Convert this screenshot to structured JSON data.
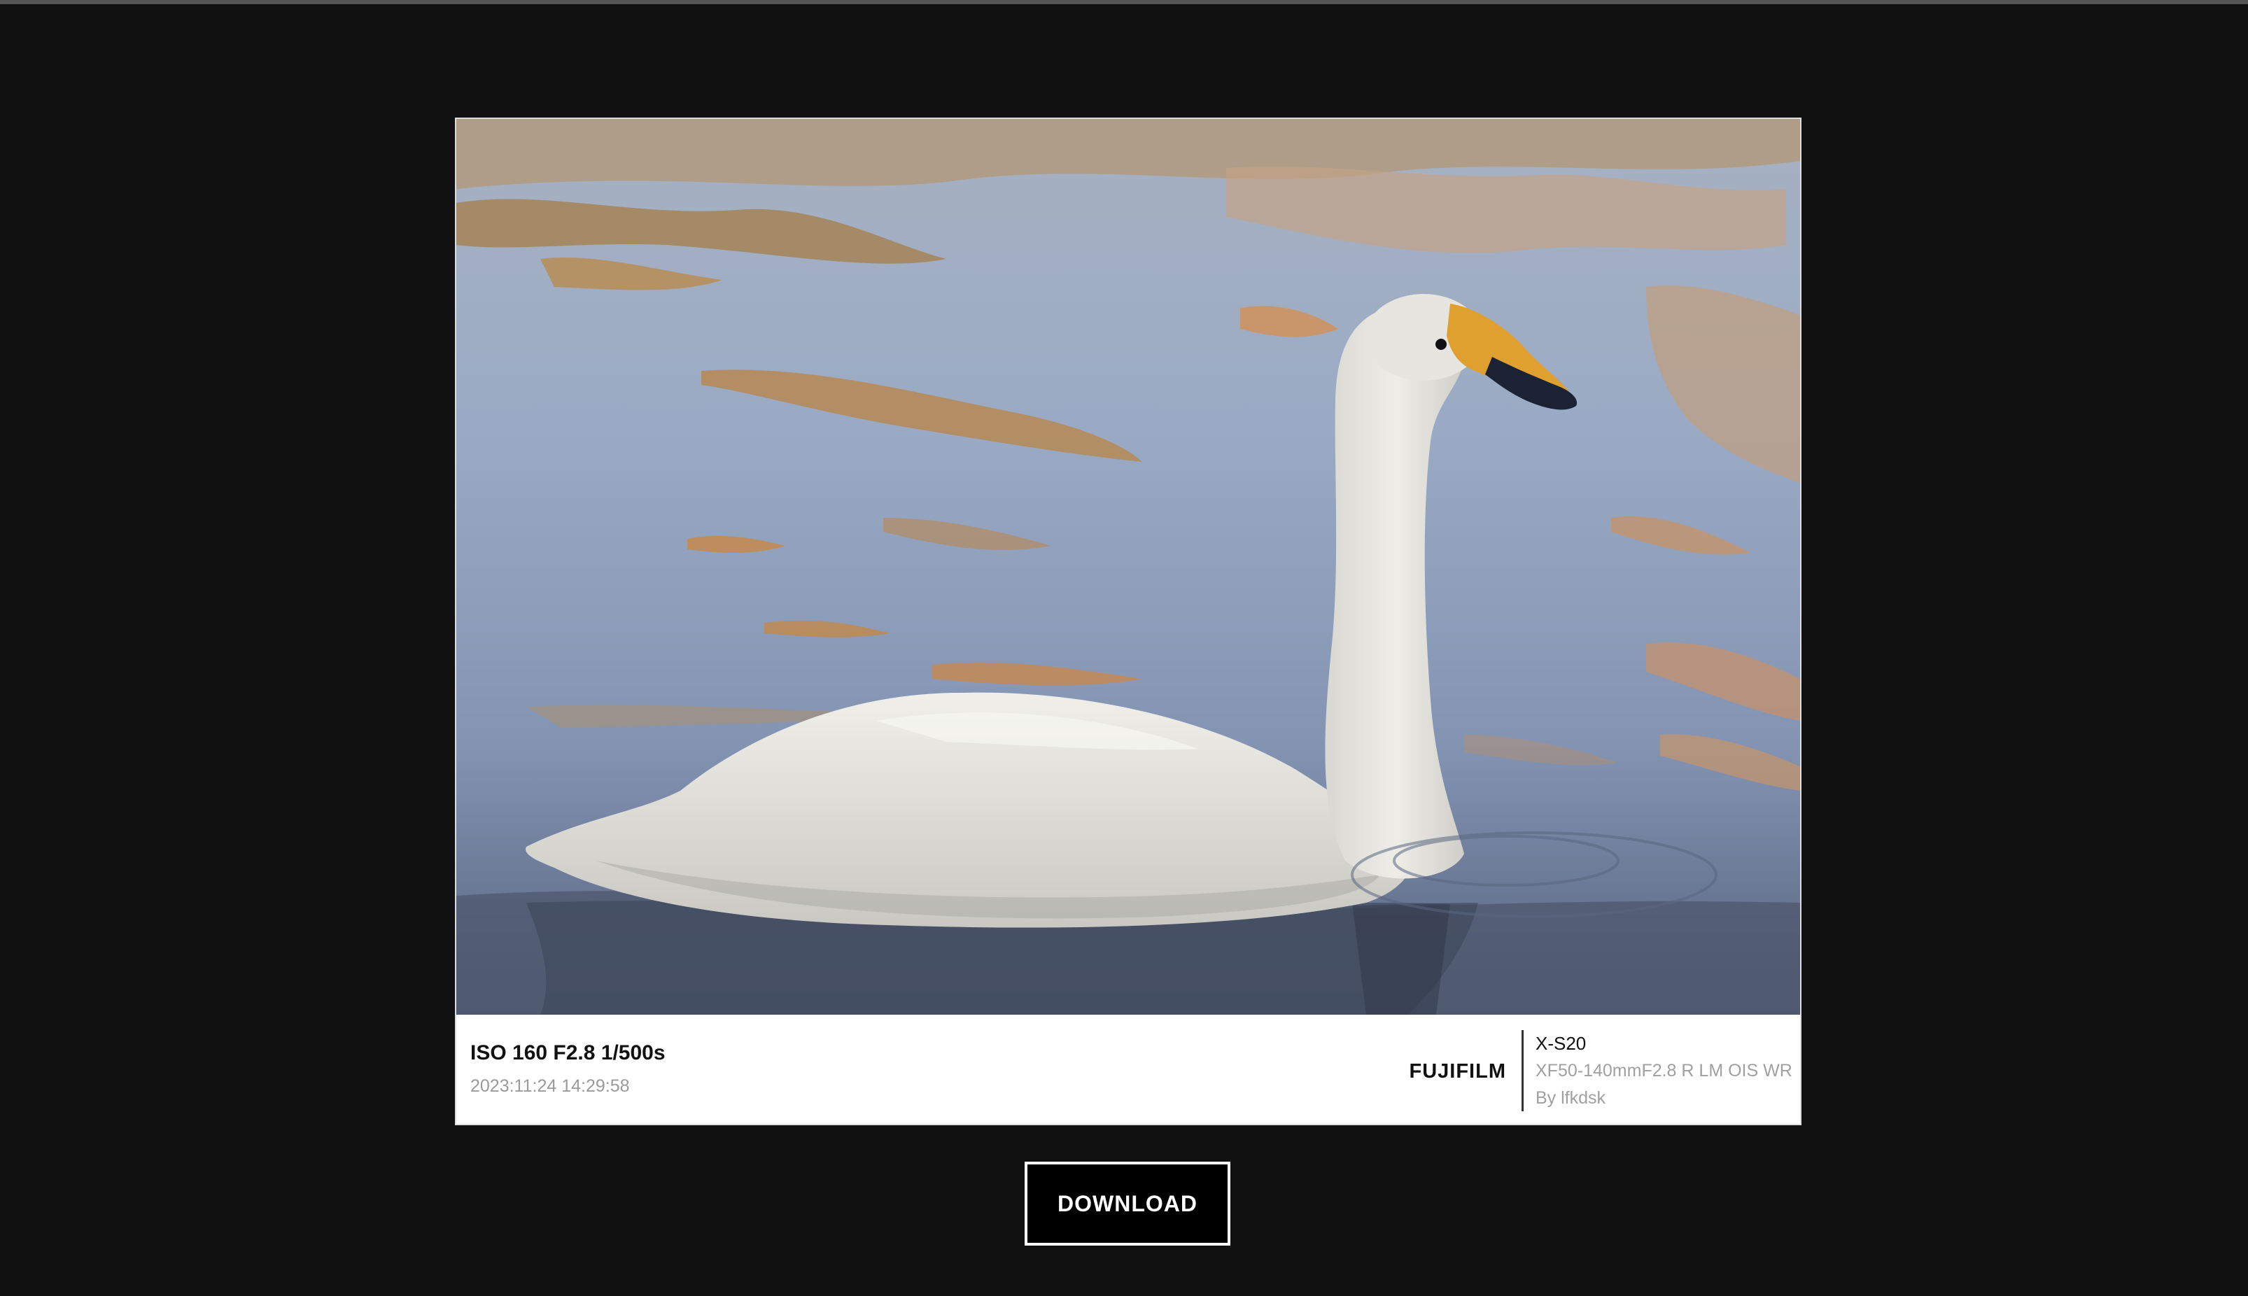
{
  "photo": {
    "subject": "swan-photo",
    "colors": {
      "water": "#8fa3c2",
      "reflection": "#c99b63",
      "swan": "#e9e8e2",
      "beak": "#e0a030"
    }
  },
  "exif": {
    "exposure": "ISO 160 F2.8 1/500s",
    "datetime": "2023:11:24 14:29:58",
    "brand": "FUJIFILM",
    "camera_model": "X-S20",
    "lens_model": "XF50-140mmF2.8 R LM OIS WR",
    "author": "By lfkdsk"
  },
  "actions": {
    "download_label": "DOWNLOAD"
  },
  "colors": {
    "background": "#111111",
    "card": "#ffffff",
    "button": "#000000",
    "button_border": "#ffffff"
  }
}
